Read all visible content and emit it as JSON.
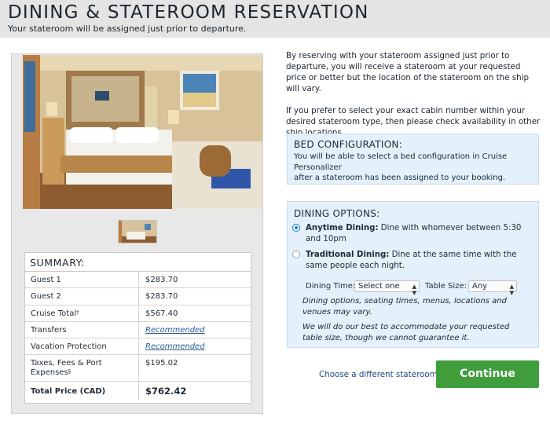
{
  "header": {
    "title": "DINING & STATEROOM RESERVATION",
    "subtitle": "Your stateroom will be assigned just prior to departure."
  },
  "summary": {
    "title": "SUMMARY:",
    "rows": [
      {
        "label": "Guest 1",
        "value": "$283.70"
      },
      {
        "label": "Guest 2",
        "value": "$283.70"
      },
      {
        "label": "Cruise Total",
        "sup": "†",
        "value": "$567.40"
      },
      {
        "label": "Transfers",
        "value": "Recommended"
      },
      {
        "label": "Vacation Protection",
        "value": "Recommended"
      },
      {
        "label": "Taxes, Fees & Port Expenses",
        "sup": "§",
        "value": "$195.02"
      },
      {
        "label": "Total Price (CAD)",
        "value": "$762.42"
      }
    ]
  },
  "intro": {
    "p1": "By reserving with your stateroom assigned just prior to departure, you will receive a stateroom at your requested price or better but the location of the stateroom on the ship will vary.",
    "p2": "If you prefer to select your exact cabin number within your desired stateroom type, then please check availability in other ship locations."
  },
  "bed": {
    "title": "BED CONFIGURATION:",
    "line1": "You will be able to select a bed configuration in Cruise Personalizer",
    "line2": "after a stateroom has been assigned to your booking."
  },
  "dining": {
    "title": "DINING OPTIONS:",
    "anytime": {
      "label": "Anytime Dining:",
      "desc": " Dine with whomever between 5:30 and 10pm",
      "selected": true
    },
    "traditional": {
      "label": "Traditional Dining:",
      "desc": " Dine at the same time with the same people each night.",
      "selected": false
    },
    "time_label": "Dining Time:",
    "time_value": "Select one",
    "size_label": "Table Size:",
    "size_value": "Any",
    "note1": "Dining options, seating times, menus, locations and venues may vary.",
    "note2": "We will do our best to accommodate your requested table size, though we cannot guarantee it."
  },
  "actions": {
    "change": "Choose a different stateroom",
    "continue": "Continue"
  },
  "colors": {
    "continue": "#3f9d3c",
    "info_box": "#e4f1fb",
    "radio_on": "#1e7fd8",
    "link": "#2a5a9a"
  }
}
